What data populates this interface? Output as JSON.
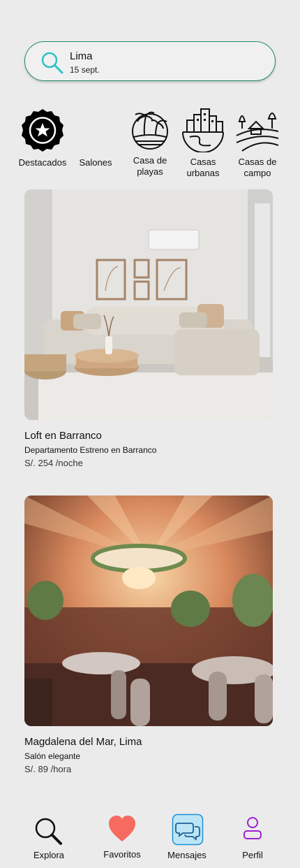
{
  "search": {
    "city": "Lima",
    "date": "15 sept."
  },
  "categories": [
    {
      "label": "Destacados",
      "icon": "star-badge-icon"
    },
    {
      "label": "Salones",
      "icon": ""
    },
    {
      "label": "Casa de playas",
      "icon": "beach-icon"
    },
    {
      "label": "Casas urbanas",
      "icon": "city-icon"
    },
    {
      "label": "Casas de campo",
      "icon": "countryside-icon"
    }
  ],
  "listings": [
    {
      "title": "Loft en Barranco",
      "subtitle": "Departamento Estreno en Barranco",
      "price": "S/. 254 /noche"
    },
    {
      "title": "Magdalena del Mar, Lima",
      "subtitle": "Salón elegante",
      "price": "S/. 89 /hora"
    }
  ],
  "nav": [
    {
      "label": "Explora",
      "icon": "search-icon"
    },
    {
      "label": "Favoritos",
      "icon": "heart-icon"
    },
    {
      "label": "Mensajes",
      "icon": "chat-icon"
    },
    {
      "label": "Perfil",
      "icon": "user-icon"
    }
  ],
  "colors": {
    "accent": "#1f8a6b",
    "search_icon": "#2bc4c9",
    "heart": "#f56b60",
    "chat": "#1e90d6",
    "profile": "#a020d0"
  }
}
